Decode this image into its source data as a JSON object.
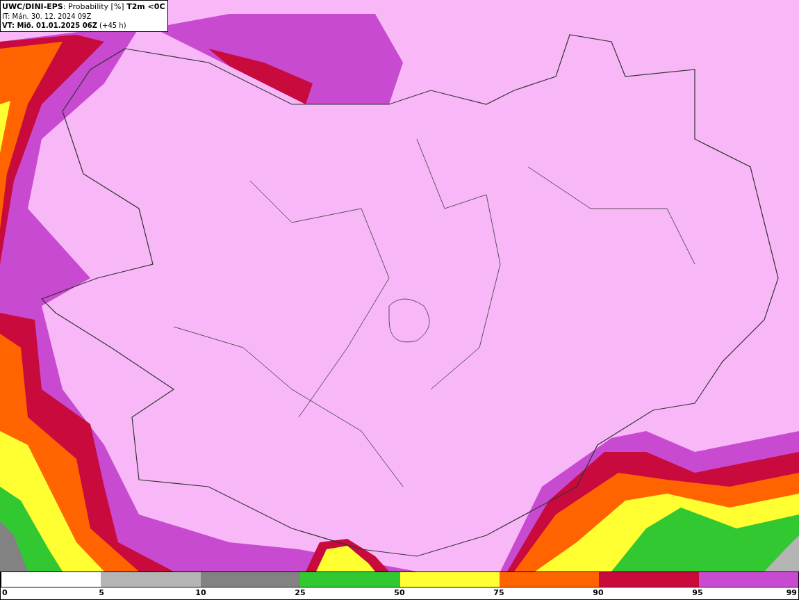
{
  "header": {
    "title": "**UWC/DINI-EPS**: Probability [%] **T2m <0C**",
    "initial_time": "IT: Mán. 30. 12. 2024 09Z",
    "valid_time": "**VT: Mið. 01.01.2025 06Z** (+45 h)"
  },
  "legend": {
    "bins": [
      {
        "color": "#ffffff"
      },
      {
        "color": "#b4b4b4"
      },
      {
        "color": "#828282"
      },
      {
        "color": "#32c832"
      },
      {
        "color": "#ffff32"
      },
      {
        "color": "#ff6400"
      },
      {
        "color": "#c80a3c"
      },
      {
        "color": "#c84ad0"
      }
    ],
    "labels": [
      "0",
      "5",
      "10",
      "25",
      "50",
      "75",
      "90",
      "95",
      "99"
    ]
  }
}
